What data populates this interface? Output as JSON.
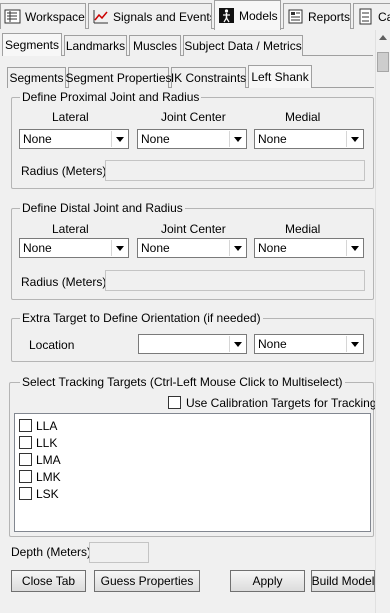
{
  "top_tabs": [
    {
      "label": "Workspace",
      "icon": "workspace-icon"
    },
    {
      "label": "Signals and Events",
      "icon": "signals-chart-icon"
    },
    {
      "label": "Models",
      "icon": "models-icon"
    },
    {
      "label": "Reports",
      "icon": "reports-icon"
    },
    {
      "label": "Ca",
      "icon": "calibration-icon"
    }
  ],
  "main_tabs": [
    "Segments",
    "Landmarks",
    "Muscles",
    "Subject Data / Metrics"
  ],
  "sub_tabs": [
    "Segments",
    "Segment Properties",
    "IK Constraints",
    "Left Shank"
  ],
  "proximal": {
    "title": "Define Proximal Joint and Radius",
    "lateral_label": "Lateral",
    "center_label": "Joint Center",
    "medial_label": "Medial",
    "lateral_value": "None",
    "center_value": "None",
    "medial_value": "None",
    "radius_label": "Radius (Meters)",
    "radius_value": ""
  },
  "distal": {
    "title": "Define Distal Joint and Radius",
    "lateral_label": "Lateral",
    "center_label": "Joint Center",
    "medial_label": "Medial",
    "lateral_value": "None",
    "center_value": "None",
    "medial_value": "None",
    "radius_label": "Radius (Meters)",
    "radius_value": ""
  },
  "extra": {
    "title": "Extra Target to Define Orientation (if needed)",
    "location_label": "Location",
    "location_value": "",
    "second_value": "None"
  },
  "tracking": {
    "title": "Select Tracking Targets (Ctrl-Left Mouse Click to Multiselect)",
    "calibration_label": "Use Calibration Targets for Tracking",
    "calibration_checked": false,
    "targets": [
      "LLA",
      "LLK",
      "LMA",
      "LMK",
      "LSK"
    ]
  },
  "depth": {
    "label": "Depth (Meters):",
    "value": ""
  },
  "buttons": {
    "close_tab": "Close Tab",
    "guess_properties": "Guess Properties",
    "apply": "Apply",
    "build_model": "Build Model"
  },
  "colors": {
    "background": "#f0f0f0",
    "border": "#a0a0a0"
  }
}
